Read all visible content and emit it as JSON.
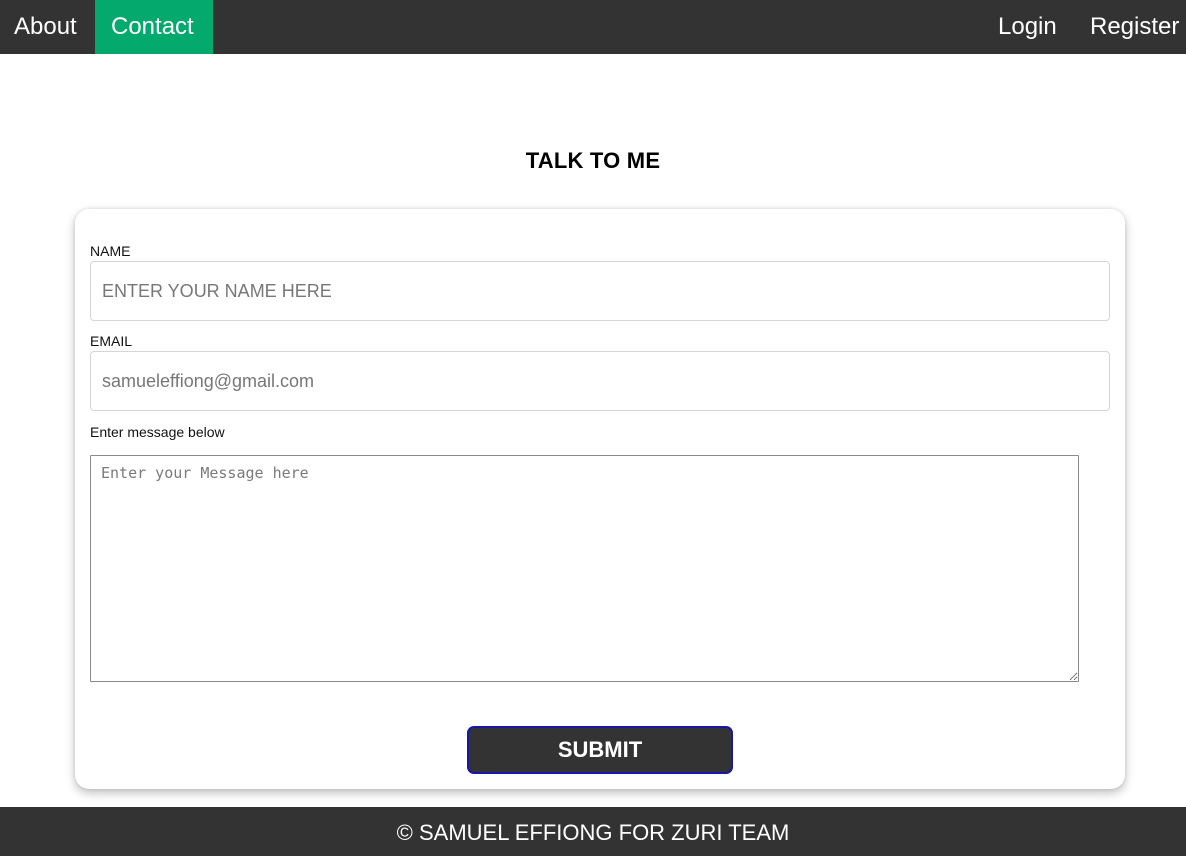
{
  "nav": {
    "about": "About",
    "contact": "Contact",
    "login": "Login",
    "register": "Register",
    "active_color": "#04AA6D",
    "bar_color": "#333333"
  },
  "page": {
    "title": "TALK TO ME"
  },
  "form": {
    "name_label": "NAME",
    "name_placeholder": "ENTER YOUR NAME HERE",
    "email_label": "EMAIL",
    "email_placeholder": "samueleffiong@gmail.com",
    "message_label": "Enter message below",
    "message_placeholder": "Enter your Message here",
    "submit_label": "SUBMIT"
  },
  "footer": {
    "text": "© SAMUEL EFFIONG FOR ZURI TEAM"
  }
}
